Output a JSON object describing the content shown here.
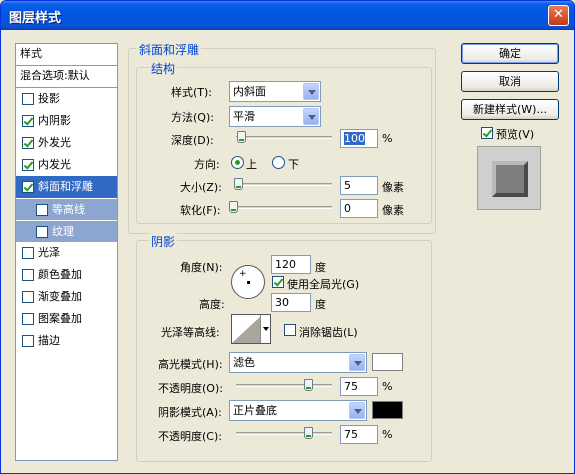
{
  "window": {
    "title": "图层样式",
    "close_glyph": "✕"
  },
  "style_list": {
    "header": "样式",
    "blend_options": "混合选项:默认",
    "items": [
      {
        "label": "投影",
        "checked": false
      },
      {
        "label": "内阴影",
        "checked": true
      },
      {
        "label": "外发光",
        "checked": true
      },
      {
        "label": "内发光",
        "checked": true
      },
      {
        "label": "斜面和浮雕",
        "checked": true,
        "selected": true
      },
      {
        "label": "等高线",
        "checked": false,
        "sub": true
      },
      {
        "label": "纹理",
        "checked": false,
        "sub": true
      },
      {
        "label": "光泽",
        "checked": false
      },
      {
        "label": "颜色叠加",
        "checked": false
      },
      {
        "label": "渐变叠加",
        "checked": false
      },
      {
        "label": "图案叠加",
        "checked": false
      },
      {
        "label": "描边",
        "checked": false
      }
    ]
  },
  "bevel": {
    "section_title": "斜面和浮雕",
    "structure_title": "结构",
    "style_label": "样式(T):",
    "style_value": "内斜面",
    "technique_label": "方法(Q):",
    "technique_value": "平滑",
    "depth_label": "深度(D):",
    "depth_value": "100",
    "depth_unit": "%",
    "direction_label": "方向:",
    "direction_up": "上",
    "direction_down": "下",
    "size_label": "大小(Z):",
    "size_value": "5",
    "size_unit": "像素",
    "soften_label": "软化(F):",
    "soften_value": "0",
    "soften_unit": "像素"
  },
  "shading": {
    "title": "阴影",
    "angle_label": "角度(N):",
    "angle_value": "120",
    "angle_unit": "度",
    "global_light_label": "使用全局光(G)",
    "altitude_label": "高度:",
    "altitude_value": "30",
    "altitude_unit": "度",
    "gloss_contour_label": "光泽等高线:",
    "anti_alias_label": "消除锯齿(L)",
    "highlight_mode_label": "高光模式(H):",
    "highlight_mode_value": "滤色",
    "highlight_color": "#ffffff",
    "highlight_opacity_label": "不透明度(O):",
    "highlight_opacity_value": "75",
    "highlight_opacity_unit": "%",
    "shadow_mode_label": "阴影模式(A):",
    "shadow_mode_value": "正片叠底",
    "shadow_color": "#000000",
    "shadow_opacity_label": "不透明度(C):",
    "shadow_opacity_value": "75",
    "shadow_opacity_unit": "%",
    "cross_glyph": "+"
  },
  "buttons": {
    "ok": "确定",
    "cancel": "取消",
    "new_style": "新建样式(W)...",
    "preview_label": "预览(V)"
  }
}
